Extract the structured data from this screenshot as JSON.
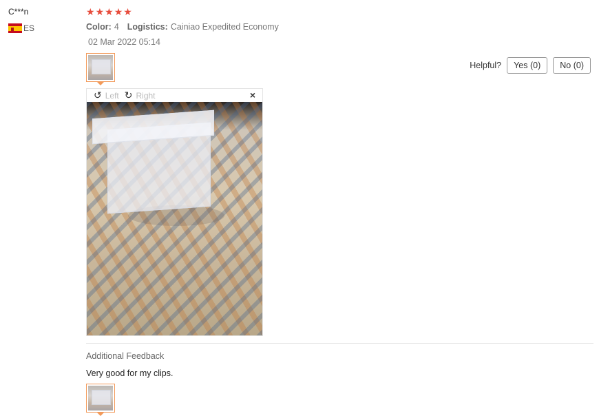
{
  "user": {
    "name": "C***n",
    "country": "ES"
  },
  "review": {
    "rating": 5,
    "color_label": "Color:",
    "color_value": "4",
    "logistics_label": "Logistics:",
    "logistics_value": "Cainiao Expedited Economy",
    "date": "02 Mar 2022 05:14"
  },
  "helpful": {
    "label": "Helpful?",
    "yes": "Yes (0)",
    "no": "No (0)"
  },
  "viewer": {
    "rotate_left": "Left",
    "rotate_right": "Right",
    "close": "×"
  },
  "additional": {
    "title": "Additional Feedback",
    "text": "Very good for my clips."
  },
  "icons": {
    "rotate_left": "rotate-left-icon",
    "rotate_right": "rotate-right-icon",
    "close": "close-icon",
    "star": "star-icon",
    "flag": "spain-flag-icon"
  },
  "colors": {
    "star": "#e74c3c",
    "thumb_border": "#f29a5a"
  }
}
